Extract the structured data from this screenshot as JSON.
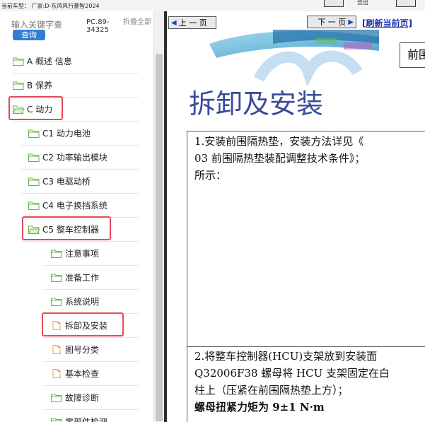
{
  "top": {
    "vehicle_label": "当前车型：  厂家:D-东风风行菱智2024",
    "right_label": "登出"
  },
  "search": {
    "placeholder": "输入关键字查",
    "button": "查询",
    "pc_code": "PC.89-34325",
    "collapse": "折叠全部"
  },
  "tree": {
    "items": [
      {
        "label": "A 概述 信息",
        "type": "folder"
      },
      {
        "label": "B 保养",
        "type": "folder"
      },
      {
        "label": "C 动力",
        "type": "folder-open"
      },
      {
        "label": "C1 动力电池",
        "type": "folder"
      },
      {
        "label": "C2 功率输出模块",
        "type": "folder"
      },
      {
        "label": "C3 电驱动桥",
        "type": "folder"
      },
      {
        "label": "C4 电子换挡系统",
        "type": "folder"
      },
      {
        "label": "C5 整车控制器",
        "type": "folder-open"
      },
      {
        "label": "注意事项",
        "type": "folder"
      },
      {
        "label": "准备工作",
        "type": "folder"
      },
      {
        "label": "系统说明",
        "type": "folder"
      },
      {
        "label": "拆卸及安装",
        "type": "doc"
      },
      {
        "label": "图号分类",
        "type": "doc"
      },
      {
        "label": "基本检查",
        "type": "doc"
      },
      {
        "label": "故障诊断",
        "type": "folder"
      },
      {
        "label": "零部件检测",
        "type": "folder"
      }
    ]
  },
  "nav": {
    "prev": "上 一 页",
    "next": "下 一 页",
    "refresh": "[刷新当前页]"
  },
  "doc": {
    "tab": "前围",
    "title": "拆卸及安装",
    "step1_line1": "1.安装前围隔热垫，安装方法详见《",
    "step1_line2": "03 前围隔热垫装配调整技术条件》；",
    "step1_line3": "所示：",
    "step2_line1": "2.将整车控制器(HCU)支架放到安装面",
    "step2_line2": "Q32006F38 螺母将 HCU 支架固定在白",
    "step2_line3": "柱上（压紧在前围隔热垫上方）；",
    "step2_torque": "螺母扭紧力矩为 9±1 N·m"
  },
  "colors": {
    "highlight": "#e84a57",
    "folder": "#6ab04c",
    "doc": "#f0a040",
    "title": "#3a4b9a",
    "link": "#1a33a6"
  }
}
